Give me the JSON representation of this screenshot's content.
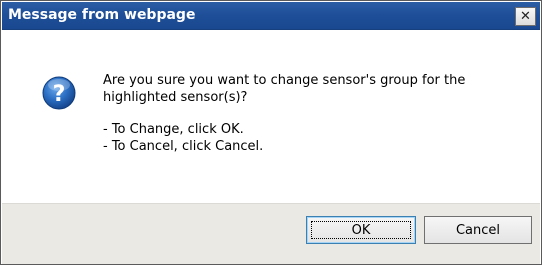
{
  "window": {
    "title": "Message from webpage",
    "close_glyph": "✕"
  },
  "icon": {
    "name": "question-icon",
    "glyph": "?",
    "color": "#1f5fb0"
  },
  "message": {
    "line1": "Are you sure you want to change sensor's group for the",
    "line2": "highlighted sensor(s)?",
    "line3": "- To Change, click OK.",
    "line4": "- To Cancel, click Cancel."
  },
  "buttons": {
    "ok_label": "OK",
    "cancel_label": "Cancel"
  },
  "colors": {
    "titlebar": "#1e4f98",
    "footer": "#ebe9e4"
  }
}
